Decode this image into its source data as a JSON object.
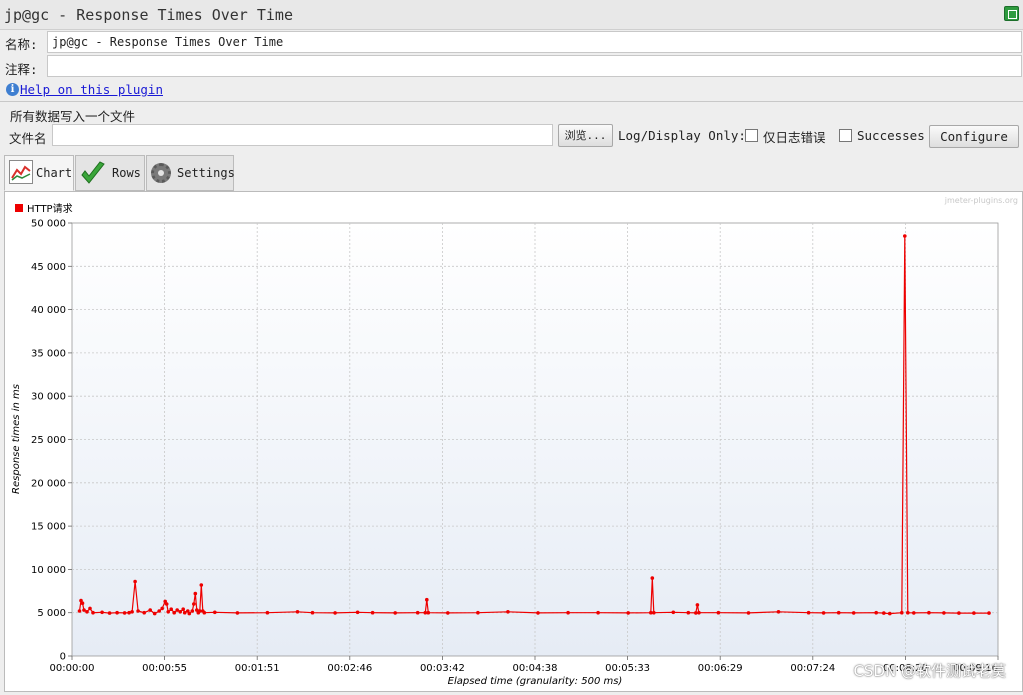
{
  "window": {
    "title": "jp@gc - Response Times Over Time"
  },
  "form": {
    "name_label": "名称:",
    "name_value": "jp@gc - Response Times Over Time",
    "comment_label": "注释:",
    "comment_value": "",
    "help_link": "Help on this plugin",
    "section_label": "所有数据写入一个文件",
    "filename_label": "文件名",
    "filename_value": "",
    "browse_button": "浏览...",
    "log_display_label": "Log/Display Only:",
    "errors_only_label": "仅日志错误",
    "errors_only_checked": false,
    "successes_label": "Successes",
    "successes_checked": false,
    "configure_button": "Configure"
  },
  "tabs": [
    {
      "label": "Chart",
      "icon": "chart-icon",
      "active": true
    },
    {
      "label": "Rows",
      "icon": "checkmark-icon",
      "active": false
    },
    {
      "label": "Settings",
      "icon": "gear-icon",
      "active": false
    }
  ],
  "watermark": "jmeter-plugins.org",
  "overlay_watermark": "CSDN @软件测试老莫",
  "colors": {
    "series": "#ee0000",
    "chart_bg_top": "#ffffff",
    "chart_bg_bottom": "#e6ecf5"
  },
  "chart_data": {
    "type": "line",
    "title": "",
    "xlabel": "Elapsed time (granularity: 500 ms)",
    "ylabel": "Response times in ms",
    "ylim": [
      0,
      50000
    ],
    "xlim_seconds": [
      0,
      616
    ],
    "grid": true,
    "legend_position": "top-left",
    "y_ticks": [
      "0",
      "5 000",
      "10 000",
      "15 000",
      "20 000",
      "25 000",
      "30 000",
      "35 000",
      "40 000",
      "45 000",
      "50 000"
    ],
    "x_ticks": [
      "00:00:00",
      "00:00:55",
      "00:01:51",
      "00:02:46",
      "00:03:42",
      "00:04:38",
      "00:05:33",
      "00:06:29",
      "00:07:24",
      "00:08:20",
      "00:09:16"
    ],
    "series": [
      {
        "name": "HTTP请求",
        "color": "#ee0000",
        "points": [
          [
            5,
            5200
          ],
          [
            6,
            6400
          ],
          [
            7,
            6100
          ],
          [
            8,
            5300
          ],
          [
            10,
            5100
          ],
          [
            12,
            5500
          ],
          [
            14,
            5000
          ],
          [
            20,
            5050
          ],
          [
            25,
            4950
          ],
          [
            30,
            5000
          ],
          [
            35,
            4980
          ],
          [
            38,
            5000
          ],
          [
            40,
            5100
          ],
          [
            42,
            8600
          ],
          [
            44,
            5200
          ],
          [
            48,
            5000
          ],
          [
            52,
            5300
          ],
          [
            55,
            4900
          ],
          [
            58,
            5200
          ],
          [
            60,
            5500
          ],
          [
            62,
            6300
          ],
          [
            63,
            6000
          ],
          [
            64,
            5100
          ],
          [
            66,
            5400
          ],
          [
            68,
            5000
          ],
          [
            70,
            5300
          ],
          [
            72,
            5100
          ],
          [
            74,
            5400
          ],
          [
            75,
            5000
          ],
          [
            77,
            5200
          ],
          [
            78,
            4900
          ],
          [
            80,
            5200
          ],
          [
            81,
            6000
          ],
          [
            82,
            7200
          ],
          [
            83,
            5300
          ],
          [
            84,
            5000
          ],
          [
            85,
            5200
          ],
          [
            86,
            8200
          ],
          [
            87,
            5200
          ],
          [
            88,
            5000
          ],
          [
            95,
            5050
          ],
          [
            110,
            4980
          ],
          [
            130,
            5000
          ],
          [
            150,
            5100
          ],
          [
            160,
            5000
          ],
          [
            175,
            4980
          ],
          [
            190,
            5050
          ],
          [
            200,
            5000
          ],
          [
            215,
            4980
          ],
          [
            230,
            5000
          ],
          [
            235,
            5000
          ],
          [
            236,
            6500
          ],
          [
            237,
            5000
          ],
          [
            250,
            4980
          ],
          [
            270,
            5000
          ],
          [
            290,
            5100
          ],
          [
            310,
            4980
          ],
          [
            330,
            5000
          ],
          [
            350,
            5000
          ],
          [
            370,
            4980
          ],
          [
            385,
            5000
          ],
          [
            386,
            9000
          ],
          [
            387,
            5000
          ],
          [
            400,
            5050
          ],
          [
            410,
            5000
          ],
          [
            415,
            4980
          ],
          [
            416,
            5900
          ],
          [
            417,
            5000
          ],
          [
            430,
            5000
          ],
          [
            450,
            4980
          ],
          [
            470,
            5100
          ],
          [
            490,
            5000
          ],
          [
            500,
            4980
          ],
          [
            510,
            5000
          ],
          [
            520,
            4980
          ],
          [
            535,
            5000
          ],
          [
            540,
            4950
          ],
          [
            544,
            4900
          ],
          [
            552,
            5000
          ],
          [
            554,
            48500
          ],
          [
            556,
            5000
          ],
          [
            560,
            4980
          ],
          [
            570,
            5000
          ],
          [
            580,
            4980
          ],
          [
            590,
            4950
          ],
          [
            600,
            4950
          ],
          [
            610,
            4950
          ]
        ]
      }
    ]
  }
}
